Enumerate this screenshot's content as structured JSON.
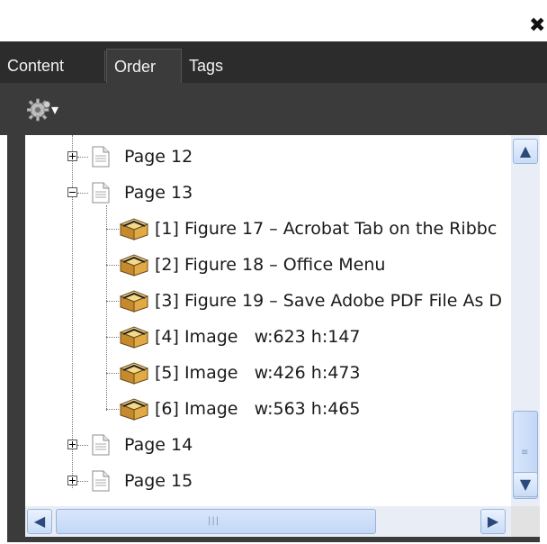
{
  "window": {
    "close_glyph": "✖"
  },
  "tabs": [
    {
      "label": "Content"
    },
    {
      "label": "Order"
    },
    {
      "label": "Tags"
    }
  ],
  "toolbar": {
    "options_icon": "gear-icon",
    "dropdown_glyph": "▾"
  },
  "tree": {
    "pages": [
      {
        "label": "Page 12",
        "expanded": false
      },
      {
        "label": "Page 13",
        "expanded": true,
        "children": [
          {
            "label": "[1] Figure 17 – Acrobat Tab on the Ribbc"
          },
          {
            "label": "[2] Figure 18 – Office Menu"
          },
          {
            "label": "[3] Figure 19 – Save Adobe PDF File As D"
          },
          {
            "label": "[4] Image   w:623 h:147"
          },
          {
            "label": "[5] Image   w:426 h:473"
          },
          {
            "label": "[6] Image   w:563 h:465"
          }
        ]
      },
      {
        "label": "Page 14",
        "expanded": false
      },
      {
        "label": "Page 15",
        "expanded": false
      }
    ]
  },
  "scrollbar": {
    "up_glyph": "▲",
    "down_glyph": "▼",
    "left_glyph": "◀",
    "right_glyph": "▶",
    "grip_glyph": "|||"
  },
  "colors": {
    "panel_dark": "#3b3b3b",
    "tabbar": "#2c2c2c",
    "scroll_accent": "#c9dcf6"
  }
}
